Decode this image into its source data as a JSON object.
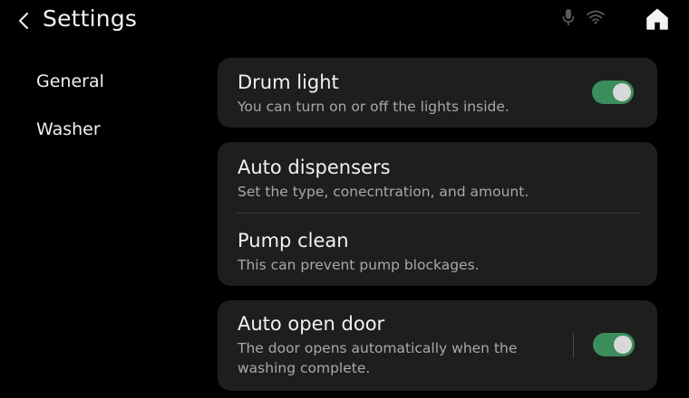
{
  "header": {
    "title": "Settings",
    "back_icon": "chevron-left-icon",
    "mic_icon": "microphone-icon",
    "wifi_icon": "wifi-icon",
    "home_icon": "home-icon"
  },
  "sidebar": {
    "items": [
      {
        "label": "General"
      },
      {
        "label": "Washer"
      }
    ]
  },
  "settings": {
    "drum_light": {
      "title": "Drum light",
      "subtitle": "You can turn on or off the lights inside.",
      "enabled": true
    },
    "auto_dispensers": {
      "title": "Auto dispensers",
      "subtitle": "Set the type, conecntration, and amount."
    },
    "pump_clean": {
      "title": "Pump clean",
      "subtitle": "This can prevent pump blockages."
    },
    "auto_open_door": {
      "title": "Auto open door",
      "subtitle_line1": "The door opens automatically when the",
      "subtitle_line2": "washing complete.",
      "enabled": true
    }
  },
  "colors": {
    "background": "#000000",
    "card": "#1d1f1d",
    "toggle_on": "#3b8d5c",
    "text_primary": "#f1f1f1",
    "text_secondary": "#a8a8a8"
  }
}
